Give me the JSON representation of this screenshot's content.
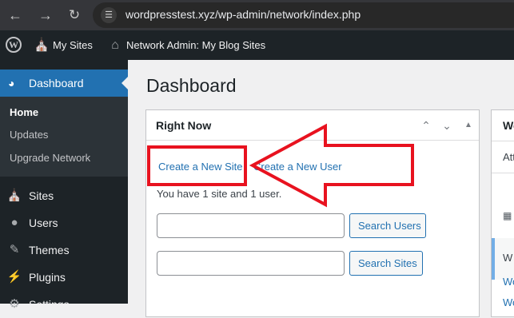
{
  "browser": {
    "url": "wordpresstest.xyz/wp-admin/network/index.php",
    "back_icon": "arrow-left-icon",
    "forward_icon": "arrow-right-icon",
    "reload_icon": "reload-icon",
    "site_info_icon": "tune-icon"
  },
  "adminbar": {
    "logo_icon": "wordpress-logo-icon",
    "my_sites": "My Sites",
    "network_admin": "Network Admin: My Blog Sites"
  },
  "sidebar": {
    "current": {
      "label": "Dashboard",
      "icon": "dashboard-icon"
    },
    "submenu": [
      "Home",
      "Updates",
      "Upgrade Network"
    ],
    "items": [
      {
        "label": "Sites",
        "icon": "sites-icon"
      },
      {
        "label": "Users",
        "icon": "users-icon"
      },
      {
        "label": "Themes",
        "icon": "themes-icon"
      },
      {
        "label": "Plugins",
        "icon": "plugins-icon"
      },
      {
        "label": "Settings",
        "icon": "settings-icon"
      }
    ]
  },
  "main": {
    "title": "Dashboard",
    "right_now": {
      "title": "Right Now",
      "create_site": "Create a New Site",
      "create_user": "Create a New User",
      "summary": "You have 1 site and 1 user.",
      "users_input_value": "",
      "sites_input_value": "",
      "search_users": "Search Users",
      "search_sites": "Search Sites"
    },
    "second_box": {
      "title": "We",
      "text": "Att",
      "notice_text": "W",
      "link1": "Wo",
      "link2": "Wo"
    }
  },
  "colors": {
    "admin_bar": "#1d2327",
    "accent": "#2271b1",
    "annotation": "#e8121f"
  }
}
